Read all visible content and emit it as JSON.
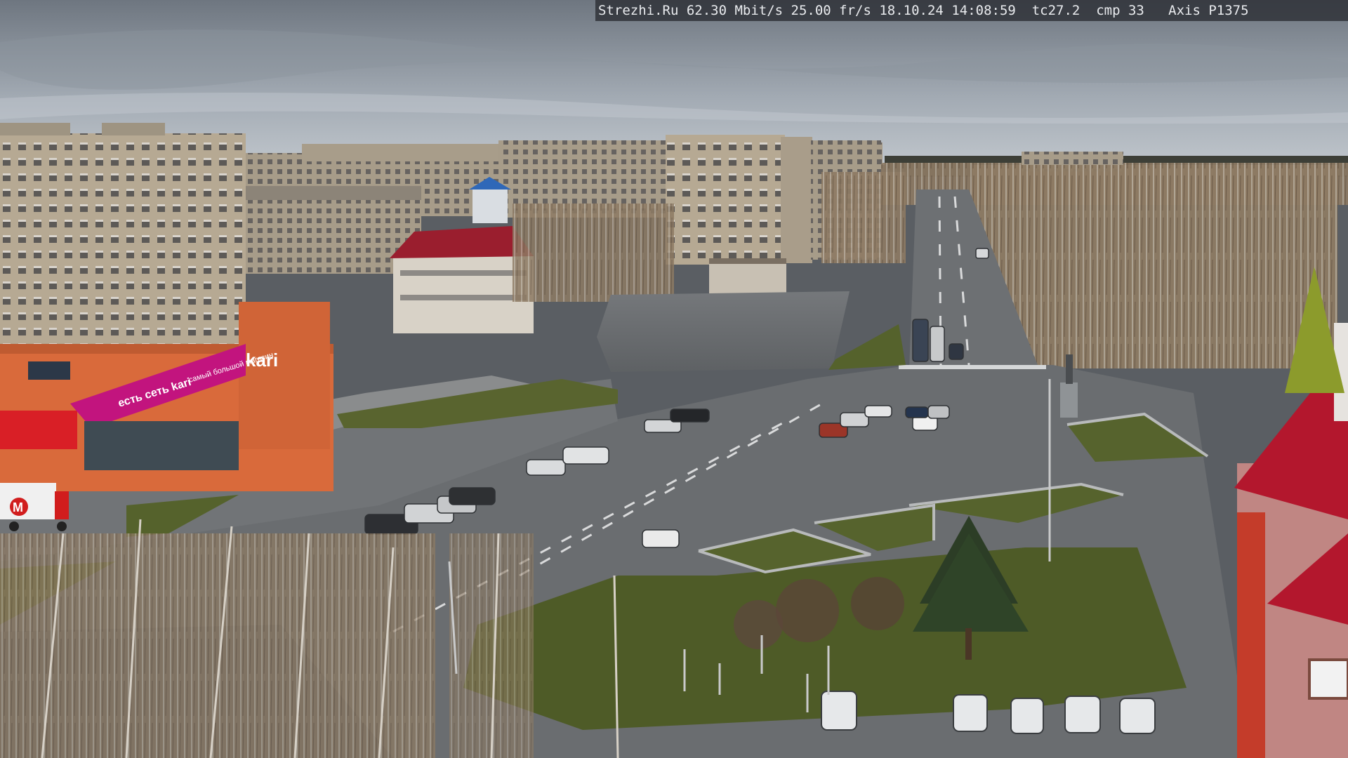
{
  "camera_overlay": {
    "text": "Strezhi.Ru 62.30 Mbit/s 25.00 fr/s 18.10.24 14:08:59  tc27.2  cmp 33   Axis P1375"
  },
  "storefront": {
    "brand": "kari",
    "banner_text": "есть сеть kari",
    "sub_text": "самый большой магазин",
    "truck_logo": "M"
  },
  "colors": {
    "sky_top": "#6f7780",
    "sky_bottom": "#b3bbc3",
    "asphalt": "#6c6f72",
    "grass": "#56632f",
    "kari_magenta": "#c2147e",
    "roof_red": "#b3172d"
  }
}
